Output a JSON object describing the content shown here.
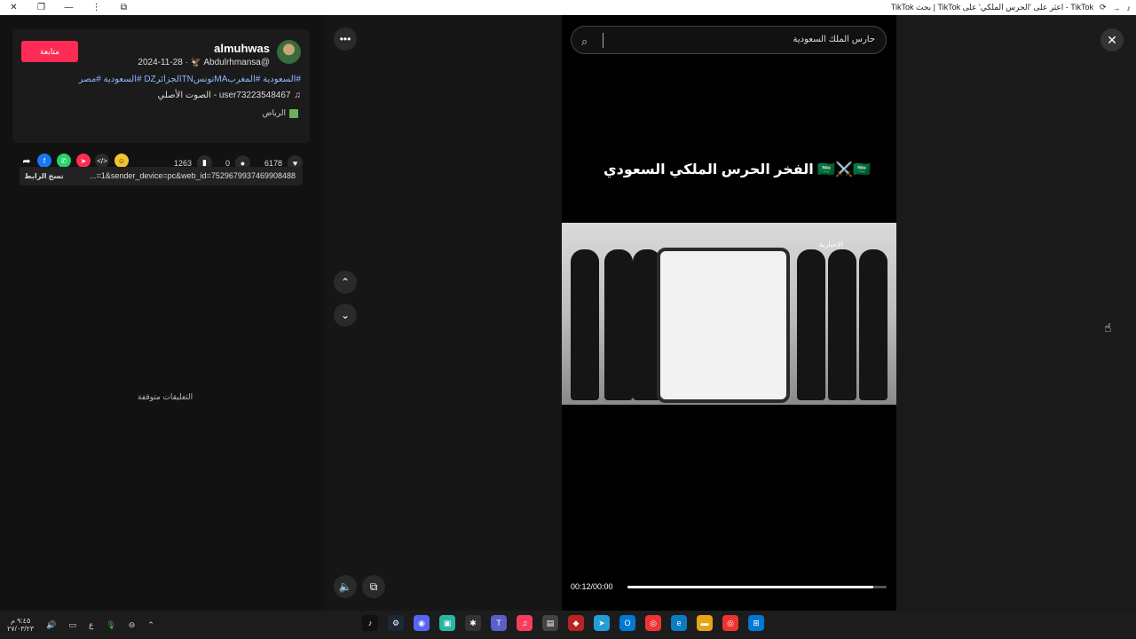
{
  "window": {
    "title": "TikTok بحث | TikTok اعثر على 'الحرس الملكي' على - TikTok"
  },
  "post": {
    "follow_label": "متابعة",
    "username": "almuhwas",
    "handle_date": "2024-11-28 · 🦅 Abdulrhmansa@",
    "hashtags": "#السعودية #المغربMAتونسTNالجزائرDZ #السعودية #مصر",
    "sound": "الصوت الأصلي - user73223548467",
    "location": "الرياض"
  },
  "stats": {
    "likes": "6178",
    "comments": "0",
    "saves": "1263"
  },
  "link": {
    "copy_label": "نسخ الرابط",
    "url": "...=1&sender_device=pc&web_id=7529679937469908488"
  },
  "comments_status": "التعليقات متوقفة",
  "search": {
    "query": "حارس الملك السعودية"
  },
  "video": {
    "caption": "الفخر الحرس الملكي السعودي 🇸🇦⚔️🇸🇦",
    "watermark": "الإخبارية",
    "time": "00:12/00:00",
    "progress": 0.95
  },
  "taskbar": {
    "clock_time": "٩:٤٥ م",
    "clock_date": "٢٧/٠٣/٢٣",
    "lang": "ع"
  },
  "colors": {
    "accent": "#fe2c55",
    "hashtag": "#8fb8ff"
  }
}
